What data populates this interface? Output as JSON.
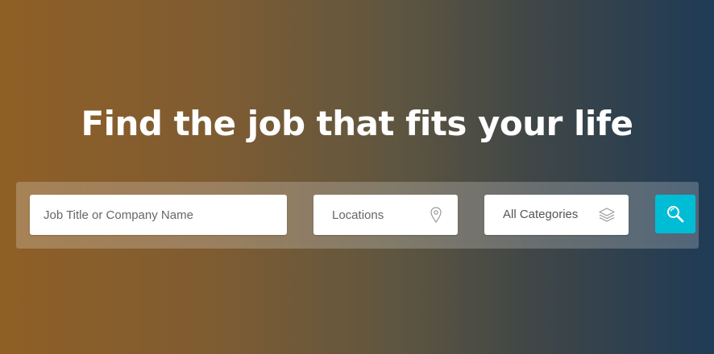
{
  "hero": {
    "headline": "Find the job that fits your life"
  },
  "search": {
    "keyword_placeholder": "Job Title or Company Name",
    "location_placeholder": "Locations",
    "category_selected": "All Categories",
    "icons": {
      "location": "map-pin-icon",
      "category": "layers-icon",
      "submit": "search-icon"
    }
  },
  "colors": {
    "gradient_left": "#8f5f26",
    "gradient_right": "#1f3b56",
    "accent": "#00bcd4",
    "headline": "#ffffff"
  }
}
